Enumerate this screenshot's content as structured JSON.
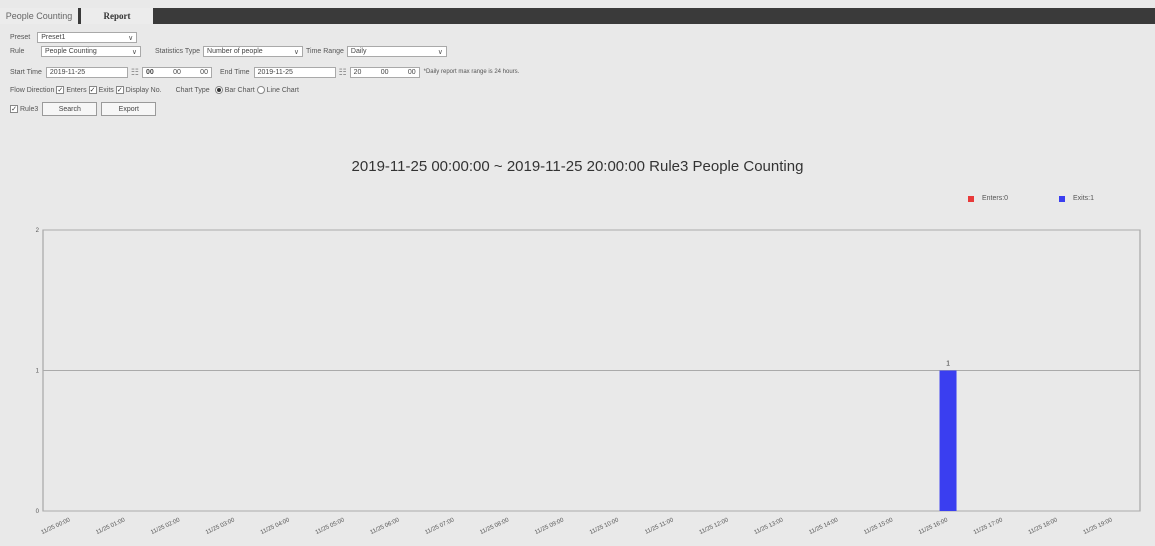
{
  "tabs": [
    {
      "label": "People Counting"
    },
    {
      "label": "Report"
    }
  ],
  "form": {
    "preset_label": "Preset",
    "preset_value": "Preset1",
    "rule_label": "Rule",
    "rule_value": "People Counting",
    "stat_type_label": "Statistics Type",
    "stat_type_value": "Number of people",
    "time_range_label": "Time Range",
    "time_range_value": "Daily",
    "start_time_label": "Start Time",
    "start_date": "2019-11-25",
    "start_h": "00",
    "start_m": "00",
    "start_s": "00",
    "end_time_label": "End Time",
    "end_date": "2019-11-25",
    "end_h": "20",
    "end_m": "00",
    "end_s": "00",
    "daily_note": "*Daily report max range is 24 hours.",
    "flow_direction_label": "Flow Direction",
    "enters_label": "Enters",
    "exits_label": "Exits",
    "display_no_label": "Display No.",
    "chart_type_label": "Chart Type",
    "bar_chart_label": "Bar Chart",
    "line_chart_label": "Line Chart",
    "rule3_label": "Rule3",
    "search_label": "Search",
    "export_label": "Export"
  },
  "chart_data": {
    "type": "bar",
    "title": "2019-11-25 00:00:00 ~ 2019-11-25 20:00:00 Rule3 People Counting",
    "categories": [
      "11/25 00:00",
      "11/25 01:00",
      "11/25 02:00",
      "11/25 03:00",
      "11/25 04:00",
      "11/25 05:00",
      "11/25 06:00",
      "11/25 07:00",
      "11/25 08:00",
      "11/25 09:00",
      "11/25 10:00",
      "11/25 11:00",
      "11/25 12:00",
      "11/25 13:00",
      "11/25 14:00",
      "11/25 15:00",
      "11/25 16:00",
      "11/25 17:00",
      "11/25 18:00",
      "11/25 19:00"
    ],
    "series": [
      {
        "name": "Enters:0",
        "color": "#e83a3a",
        "values": [
          0,
          0,
          0,
          0,
          0,
          0,
          0,
          0,
          0,
          0,
          0,
          0,
          0,
          0,
          0,
          0,
          0,
          0,
          0,
          0
        ]
      },
      {
        "name": "Exits:1",
        "color": "#3a3ef0",
        "values": [
          0,
          0,
          0,
          0,
          0,
          0,
          0,
          0,
          0,
          0,
          0,
          0,
          0,
          0,
          0,
          0,
          1,
          0,
          0,
          0
        ]
      }
    ],
    "yticks": [
      0,
      1,
      2
    ],
    "ylim": [
      0,
      2
    ],
    "data_labels": [
      "1"
    ],
    "legend_position": "top-right",
    "grid": true
  }
}
